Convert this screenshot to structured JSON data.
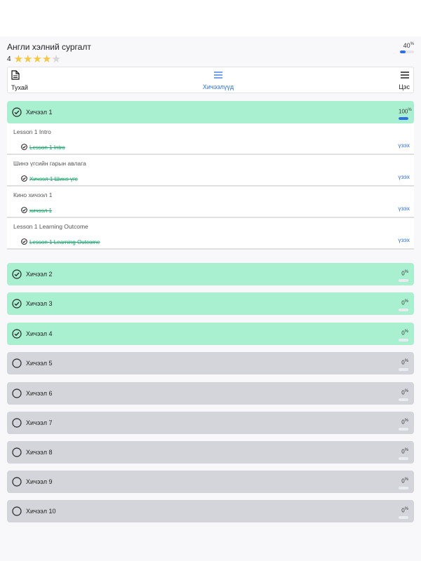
{
  "course": {
    "title": "Англи хэлний сургалт",
    "rating": "4",
    "stars_filled": 4,
    "stars_total": 5,
    "progress_value": "40",
    "progress_unit": "%",
    "progress_fraction": 0.4
  },
  "tabs": {
    "about": "Тухай",
    "lessons": "Хичээлүүд",
    "menu": "Цэс"
  },
  "lesson1": {
    "name": "Хичээл 1",
    "progress": "100",
    "unit": "%",
    "subitems": [
      {
        "title": "Lesson 1 Intro",
        "item": "Lesson 1 Intro",
        "action": "үзэх"
      },
      {
        "title": "Шинэ үгсийн гарын авлага",
        "item": "Хичээл 1 Шинэ үгс",
        "action": "үзэх"
      },
      {
        "title": "Кино хичээл 1",
        "item": "хичээл 1",
        "action": "үзэх"
      },
      {
        "title": "Lesson 1 Learning Outcome",
        "item": "Lesson 1 Learning Outcome",
        "action": "үзэх"
      }
    ]
  },
  "lessons": [
    {
      "name": "Хичээл 2",
      "progress": "0",
      "unit": "%",
      "done": true
    },
    {
      "name": "Хичээл 3",
      "progress": "0",
      "unit": "%",
      "done": true
    },
    {
      "name": "Хичээл 4",
      "progress": "0",
      "unit": "%",
      "done": true
    },
    {
      "name": "Хичээл 5",
      "progress": "0",
      "unit": "%",
      "done": false
    },
    {
      "name": "Хичээл 6",
      "progress": "0",
      "unit": "%",
      "done": false
    },
    {
      "name": "Хичээл 7",
      "progress": "0",
      "unit": "%",
      "done": false
    },
    {
      "name": "Хичээл 8",
      "progress": "0",
      "unit": "%",
      "done": false
    },
    {
      "name": "Хичээл 9",
      "progress": "0",
      "unit": "%",
      "done": false
    },
    {
      "name": "Хичээл 10",
      "progress": "0",
      "unit": "%",
      "done": false
    }
  ],
  "colors": {
    "accent": "#2f6fe5",
    "done_bg": "#a8f0d0",
    "todo_bg": "#d3d5da",
    "strike_green": "#1aa36b",
    "star": "#f5c842"
  },
  "icons": {
    "about": "document-icon",
    "lessons": "list-icon",
    "menu": "hamburger-icon",
    "done": "check-circle-icon",
    "todo": "empty-circle-icon"
  }
}
